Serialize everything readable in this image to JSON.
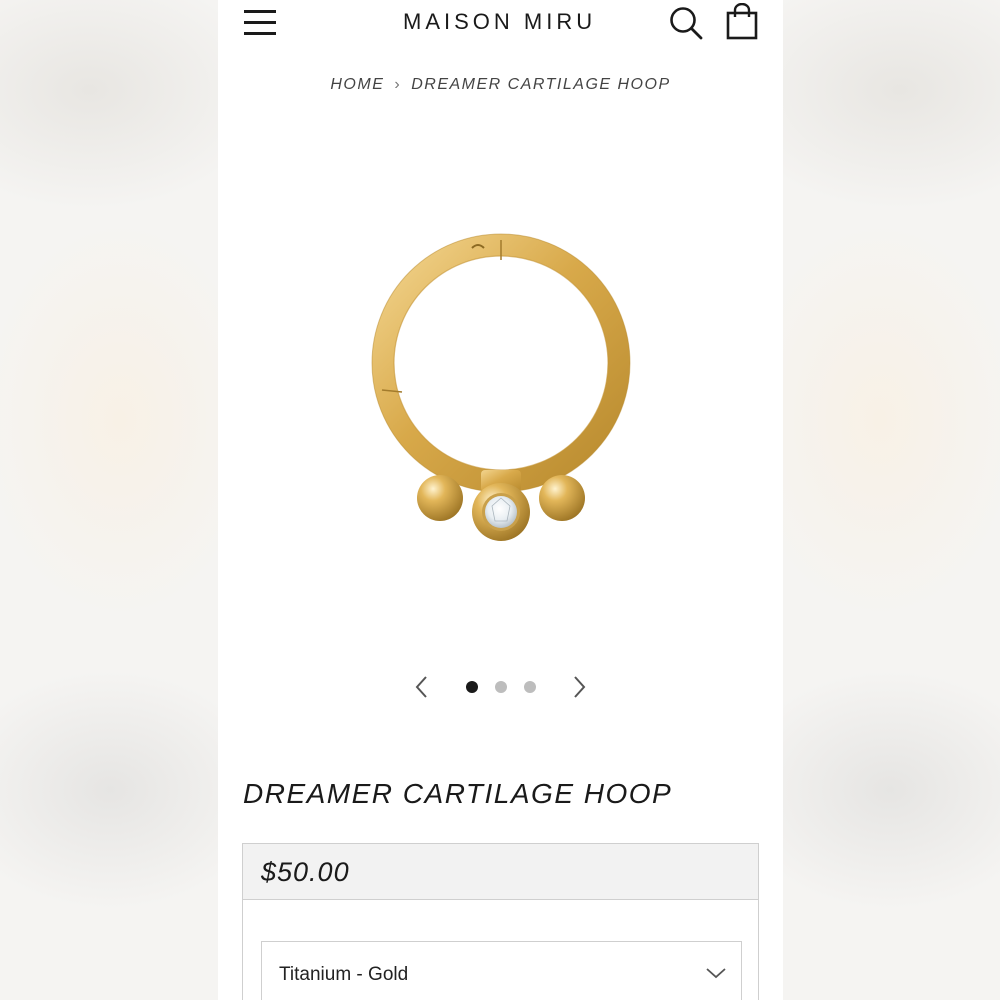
{
  "header": {
    "logo_text": "MAISON MIRU",
    "menu_icon": "hamburger-menu-icon",
    "search_icon": "search-icon",
    "cart_icon": "shopping-bag-icon"
  },
  "breadcrumb": {
    "home": "HOME",
    "current": "DREAMER CARTILAGE HOOP"
  },
  "carousel": {
    "total_slides": 3,
    "active_index": 0,
    "prev_icon": "chevron-left-icon",
    "next_icon": "chevron-right-icon"
  },
  "product": {
    "title": "DREAMER CARTILAGE HOOP",
    "price": "$50.00",
    "variant_selected": "Titanium - Gold",
    "variant_icon": "chevron-down-icon"
  },
  "colors": {
    "gold": "#d8a94a",
    "text": "#1a1a1a",
    "active_dot": "#1a1a1a",
    "inactive_dot": "#bdbdbd",
    "price_bar": "#f2f2f2"
  }
}
